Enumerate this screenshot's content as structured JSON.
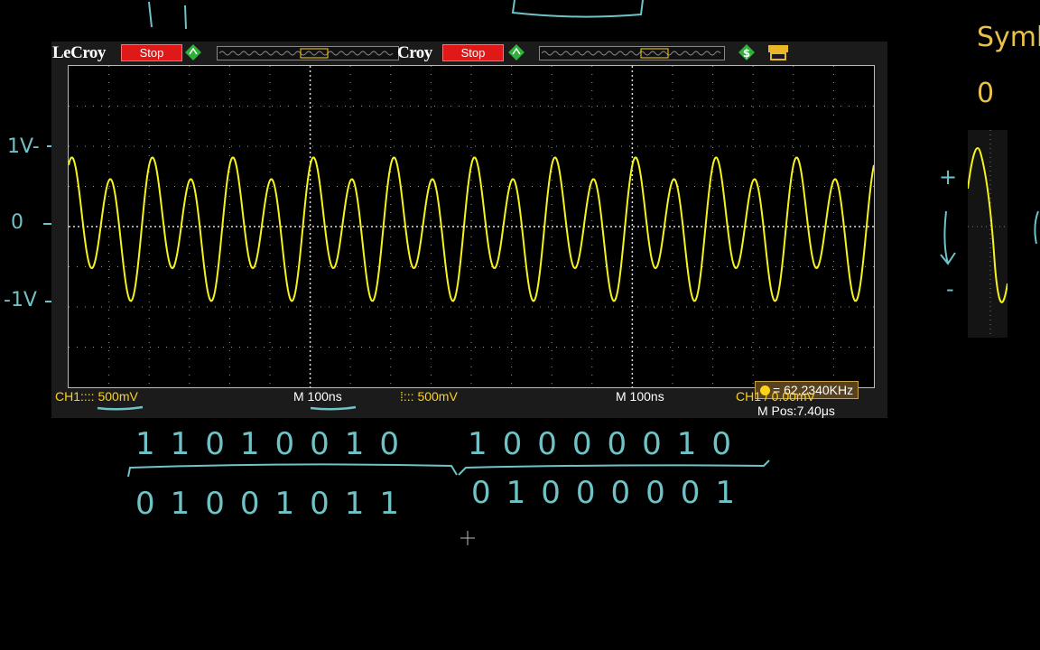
{
  "scope": {
    "brand": "LeCroy",
    "brand_partial": "Croy",
    "stop_label": "Stop",
    "ch1_scale": "CH1:::: 500mV",
    "timebase_left": "M 100ns",
    "ch_scale_right": "500mV",
    "timebase_right": "M 100ns",
    "trigger": "CH1 / 0.00mV",
    "mpos": "M Pos:7.40μs",
    "frequency": "= 62.2340KHz"
  },
  "axis_labels": {
    "plus_1v": "1V-",
    "zero": "0",
    "minus_1v": "-1V"
  },
  "handwriting": {
    "bits_row1_group1": "11010010",
    "bits_row1_group2": "10000010",
    "bits_row2_group1": "01001011",
    "bits_row2_group2": "01000001"
  },
  "right_panel": {
    "title": "Symb",
    "zero": "0",
    "plus": "+",
    "minus": "-"
  },
  "colors": {
    "trace": "#f6f31c",
    "handwriting": "#6fc3c6",
    "symbol_text": "#e8c24a",
    "stop": "#e01818"
  }
}
